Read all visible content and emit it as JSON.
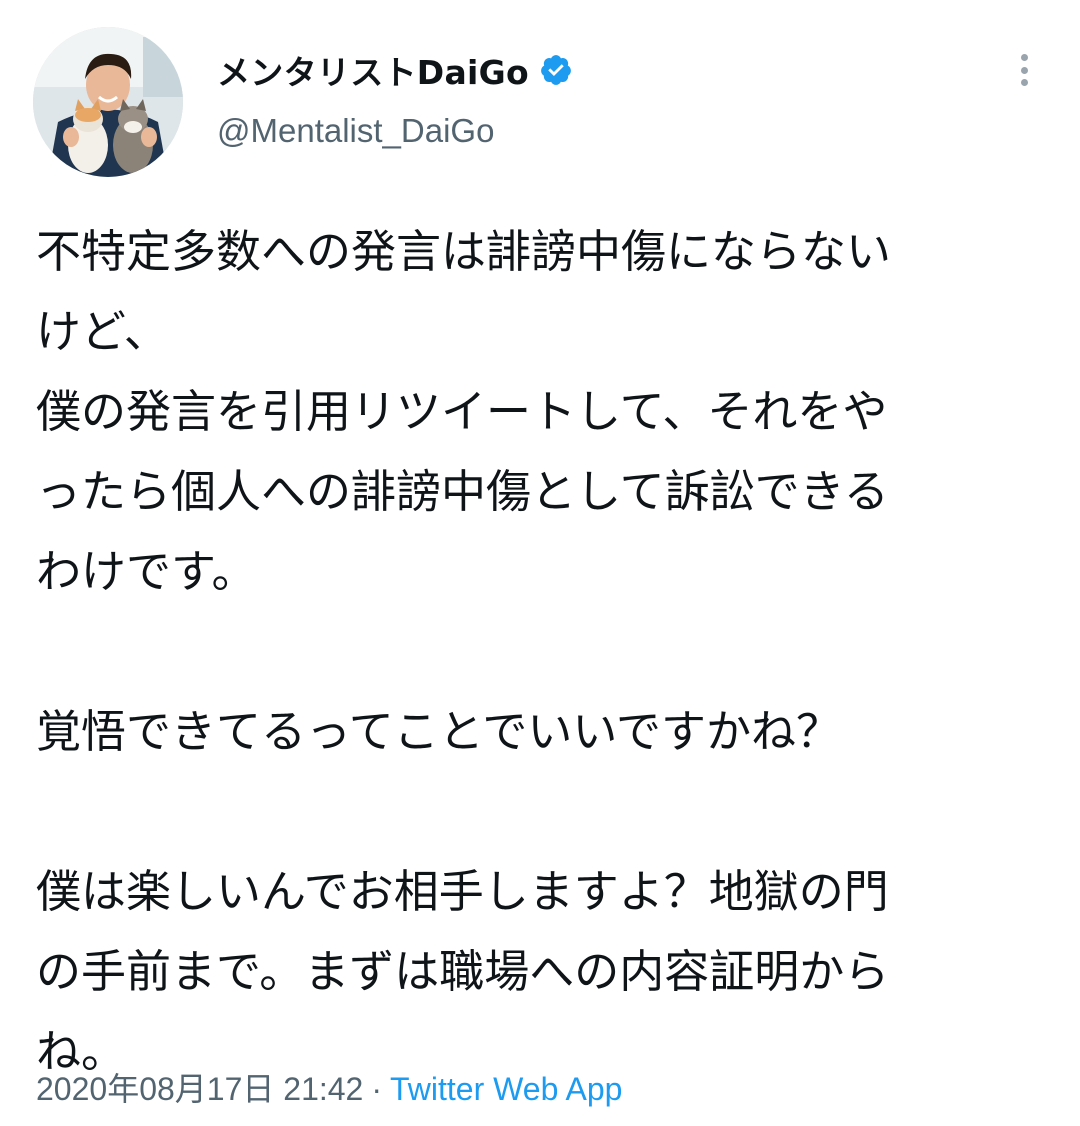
{
  "user": {
    "display_name": "メンタリストDaiGo",
    "handle": "@Mentalist_DaiGo",
    "verified": true
  },
  "tweet": {
    "lines": [
      "不特定多数への発言は誹謗中傷にならない",
      "けど、",
      "僕の発言を引用リツイートして、それをや",
      "ったら個人への誹謗中傷として訴訟できる",
      "わけです。",
      "",
      "覚悟できてるってことでいいですかね？",
      "",
      "僕は楽しいんでお相手しますよ？地獄の門",
      "の手前まで。まずは職場への内容証明から",
      "ね。"
    ],
    "timestamp": "2020年08月17日 21:42",
    "separator": "·",
    "source": "Twitter Web App"
  },
  "colors": {
    "verified_badge": "#1d9bf0",
    "source_link": "#1d9bf0",
    "secondary_text": "#536471"
  },
  "icons": {
    "verified": "verified-badge-icon",
    "more": "more-vertical-icon"
  }
}
